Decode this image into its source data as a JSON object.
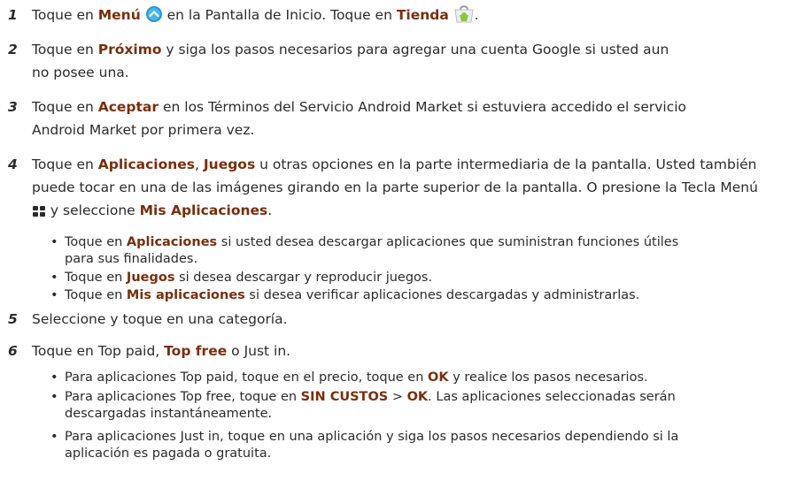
{
  "steps": [
    {
      "num": "1",
      "segments": [
        "Toque en ",
        "Menú",
        " en la Pantalla de Inicio. Toque en ",
        "Tienda",
        "."
      ]
    },
    {
      "num": "2",
      "segments": [
        "Toque en ",
        "Próximo",
        " y siga los pasos necesarios para agregar una cuenta Google si usted aun no posee una."
      ]
    },
    {
      "num": "3",
      "segments": [
        "Toque en ",
        "Aceptar",
        " en los Términos del Servicio Android Market si estuviera accedido el servicio Android Market por primera vez."
      ]
    },
    {
      "num": "4",
      "segments": [
        "Toque en ",
        "Aplicaciones",
        ", ",
        "Juegos",
        " u otras opciones en la parte intermediaria de la pantalla. Usted también puede tocar en una de las imágenes girando en la parte superior de la pantalla. O presione la Tecla Menú",
        " y seleccione ",
        "Mis Aplicaciones",
        "."
      ],
      "bullets": [
        [
          "Toque en ",
          "Aplicaciones",
          " si usted desea descargar aplicaciones que suministran funciones útiles para sus finalidades."
        ],
        [
          "Toque en ",
          "Juegos",
          " si desea descargar y reproducir juegos."
        ],
        [
          "Toque en ",
          "Mis aplicaciones",
          " si desea verificar aplicaciones descargadas y administrarlas."
        ]
      ]
    },
    {
      "num": "5",
      "segments": [
        "Seleccione y toque en una categoría."
      ]
    },
    {
      "num": "6",
      "segments": [
        "Toque en Top paid, ",
        "Top free",
        " o Just in."
      ],
      "bullets": [
        [
          "Para aplicaciones Top paid, toque en el precio, toque en ",
          "OK",
          " y realice los pasos necesarios."
        ],
        [
          "Para aplicaciones Top free, toque en ",
          "SIN CUSTOS",
          " > ",
          "OK",
          ". Las aplicaciones seleccionadas serán descargadas instantáneamente."
        ],
        [
          "Para aplicaciones Just in, toque en una aplicación y siga los pasos necesarios dependiendo si la aplicación es pagada o gratuita."
        ]
      ]
    }
  ],
  "bullet_symbol": "•",
  "icons": {
    "menu_launcher": "menu-circle-icon",
    "market": "market-bag-icon",
    "menu_key": "menu-key-icon"
  },
  "colors": {
    "highlight": "#7a2e0e",
    "text": "#2b2b2b",
    "icon_blue": "#1e9ad6",
    "icon_green": "#8cc63f"
  }
}
